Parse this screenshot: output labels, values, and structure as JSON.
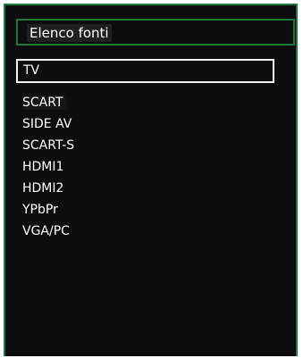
{
  "menu": {
    "title": "Elenco fonti",
    "sources": [
      {
        "label": "TV",
        "selected": true
      },
      {
        "label": "SCART",
        "selected": false
      },
      {
        "label": "SIDE AV",
        "selected": false
      },
      {
        "label": "SCART-S",
        "selected": false
      },
      {
        "label": "HDMI1",
        "selected": false
      },
      {
        "label": "HDMI2",
        "selected": false
      },
      {
        "label": "YPbPr",
        "selected": false
      },
      {
        "label": "VGA/PC",
        "selected": false
      }
    ]
  },
  "colors": {
    "panel_background": "#0d0d0d",
    "frame_green": "#1e7a3a",
    "text": "#ffffff",
    "selection_border": "#f2f2f2"
  }
}
